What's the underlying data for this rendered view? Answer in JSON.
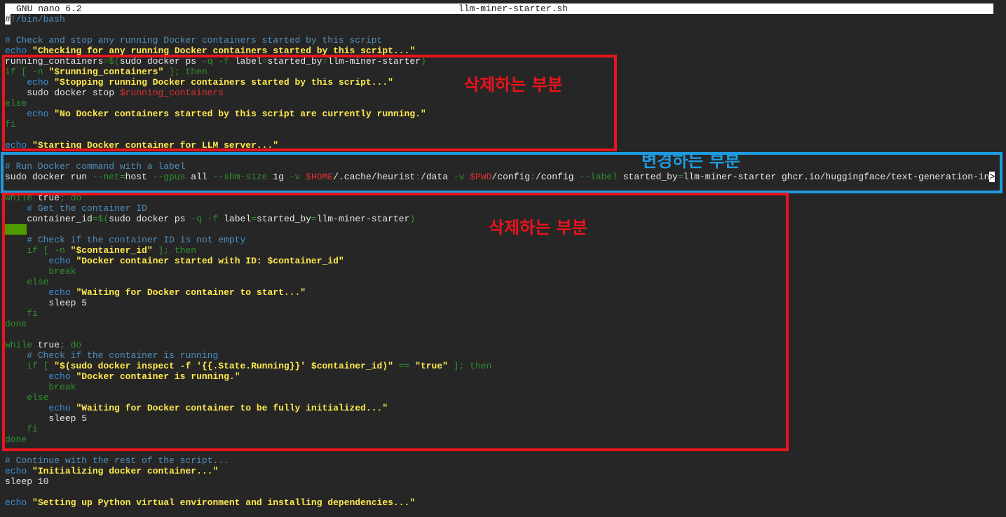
{
  "titlebar": {
    "app_name": "GNU nano 6.2",
    "file_name": "llm-miner-starter.sh"
  },
  "annotations": {
    "delete_label_1": "삭제하는 부분",
    "change_label": "변경하는 부분",
    "delete_label_2": "삭제하는 부분"
  },
  "colors": {
    "background": "#262626",
    "comment": "#4f8fbf",
    "keyword": "#2f8f2f",
    "builtin": "#3b8fd6",
    "string": "#ffe94d",
    "variable": "#e03030",
    "annotation_red": "#e8141e",
    "annotation_blue": "#1e9be0"
  },
  "lines": [
    [
      [
        "cur",
        "#"
      ],
      [
        "c",
        "!/bin/bash"
      ]
    ],
    [],
    [
      [
        "c",
        "# Check and stop any running Docker containers started by this script"
      ]
    ],
    [
      [
        "b",
        "echo"
      ],
      [
        "t",
        " "
      ],
      [
        "s",
        "\"Checking for any running Docker containers started by this script...\""
      ]
    ],
    [
      [
        "t",
        "running_containers"
      ],
      [
        "o",
        "="
      ],
      [
        "k",
        "$("
      ],
      [
        "t",
        "sudo docker ps "
      ],
      [
        "k",
        "-q"
      ],
      [
        "t",
        " "
      ],
      [
        "k",
        "-f"
      ],
      [
        "t",
        " label"
      ],
      [
        "o",
        "="
      ],
      [
        "t",
        "started_by"
      ],
      [
        "o",
        "="
      ],
      [
        "t",
        "llm-miner-starter"
      ],
      [
        "k",
        ")"
      ]
    ],
    [
      [
        "k",
        "if [ -n "
      ],
      [
        "s",
        "\"$running_containers\""
      ],
      [
        "k",
        " ]; then"
      ]
    ],
    [
      [
        "t",
        "    "
      ],
      [
        "b",
        "echo"
      ],
      [
        "t",
        " "
      ],
      [
        "s",
        "\"Stopping running Docker containers started by this script...\""
      ]
    ],
    [
      [
        "t",
        "    sudo docker stop "
      ],
      [
        "v",
        "$running_containers"
      ]
    ],
    [
      [
        "k",
        "else"
      ]
    ],
    [
      [
        "t",
        "    "
      ],
      [
        "b",
        "echo"
      ],
      [
        "t",
        " "
      ],
      [
        "s",
        "\"No Docker containers started by this script are currently running.\""
      ]
    ],
    [
      [
        "k",
        "fi"
      ]
    ],
    [],
    [
      [
        "b",
        "echo"
      ],
      [
        "t",
        " "
      ],
      [
        "s",
        "\"Starting Docker container for LLM server...\""
      ]
    ],
    [],
    [
      [
        "c",
        "# Run Docker command with a label"
      ]
    ],
    [
      [
        "t",
        "sudo docker run "
      ],
      [
        "k",
        "--net"
      ],
      [
        "o",
        "="
      ],
      [
        "t",
        "host "
      ],
      [
        "k",
        "--gpus"
      ],
      [
        "t",
        " all "
      ],
      [
        "k",
        "--shm-size"
      ],
      [
        "t",
        " 1g "
      ],
      [
        "k",
        "-v"
      ],
      [
        "t",
        " "
      ],
      [
        "v",
        "$HOME"
      ],
      [
        "t",
        "/.cache/heurist"
      ],
      [
        "o",
        ":"
      ],
      [
        "t",
        "/data "
      ],
      [
        "k",
        "-v"
      ],
      [
        "t",
        " "
      ],
      [
        "v",
        "$PWD"
      ],
      [
        "t",
        "/config"
      ],
      [
        "o",
        ":"
      ],
      [
        "t",
        "/config "
      ],
      [
        "k",
        "--label"
      ],
      [
        "t",
        " started_by"
      ],
      [
        "o",
        "="
      ],
      [
        "t",
        "llm-miner-starter ghcr.io/huggingface/text-generation-in"
      ],
      [
        "more",
        ">"
      ]
    ],
    [],
    [
      [
        "k",
        "while"
      ],
      [
        "t",
        " true"
      ],
      [
        "k",
        "; do"
      ]
    ],
    [
      [
        "t",
        "    "
      ],
      [
        "c",
        "# Get the container ID"
      ]
    ],
    [
      [
        "t",
        "    container_id"
      ],
      [
        "o",
        "="
      ],
      [
        "k",
        "$("
      ],
      [
        "t",
        "sudo docker ps "
      ],
      [
        "k",
        "-q"
      ],
      [
        "t",
        " "
      ],
      [
        "k",
        "-f"
      ],
      [
        "t",
        " label"
      ],
      [
        "o",
        "="
      ],
      [
        "t",
        "started_by"
      ],
      [
        "o",
        "="
      ],
      [
        "t",
        "llm-miner-starter"
      ],
      [
        "k",
        ")"
      ]
    ],
    [
      [
        "ws",
        "    "
      ]
    ],
    [
      [
        "t",
        "    "
      ],
      [
        "c",
        "# Check if the container ID is not empty"
      ]
    ],
    [
      [
        "t",
        "    "
      ],
      [
        "k",
        "if [ -n "
      ],
      [
        "s",
        "\"$container_id\""
      ],
      [
        "k",
        " ]; then"
      ]
    ],
    [
      [
        "t",
        "        "
      ],
      [
        "b",
        "echo"
      ],
      [
        "t",
        " "
      ],
      [
        "s",
        "\"Docker container started with ID: $container_id\""
      ]
    ],
    [
      [
        "t",
        "        "
      ],
      [
        "k",
        "break"
      ]
    ],
    [
      [
        "t",
        "    "
      ],
      [
        "k",
        "else"
      ]
    ],
    [
      [
        "t",
        "        "
      ],
      [
        "b",
        "echo"
      ],
      [
        "t",
        " "
      ],
      [
        "s",
        "\"Waiting for Docker container to start...\""
      ]
    ],
    [
      [
        "t",
        "        sleep 5"
      ]
    ],
    [
      [
        "t",
        "    "
      ],
      [
        "k",
        "fi"
      ]
    ],
    [
      [
        "k",
        "done"
      ]
    ],
    [],
    [
      [
        "k",
        "while"
      ],
      [
        "t",
        " true"
      ],
      [
        "k",
        "; do"
      ]
    ],
    [
      [
        "t",
        "    "
      ],
      [
        "c",
        "# Check if the container is running"
      ]
    ],
    [
      [
        "t",
        "    "
      ],
      [
        "k",
        "if [ "
      ],
      [
        "s",
        "\"$(sudo docker inspect -f '{{.State.Running}}' $container_id)\""
      ],
      [
        "k",
        " == "
      ],
      [
        "s",
        "\"true\""
      ],
      [
        "k",
        " ]; then"
      ]
    ],
    [
      [
        "t",
        "        "
      ],
      [
        "b",
        "echo"
      ],
      [
        "t",
        " "
      ],
      [
        "s",
        "\"Docker container is running.\""
      ]
    ],
    [
      [
        "t",
        "        "
      ],
      [
        "k",
        "break"
      ]
    ],
    [
      [
        "t",
        "    "
      ],
      [
        "k",
        "else"
      ]
    ],
    [
      [
        "t",
        "        "
      ],
      [
        "b",
        "echo"
      ],
      [
        "t",
        " "
      ],
      [
        "s",
        "\"Waiting for Docker container to be fully initialized...\""
      ]
    ],
    [
      [
        "t",
        "        sleep 5"
      ]
    ],
    [
      [
        "t",
        "    "
      ],
      [
        "k",
        "fi"
      ]
    ],
    [
      [
        "k",
        "done"
      ]
    ],
    [],
    [
      [
        "c",
        "# Continue with the rest of the script..."
      ]
    ],
    [
      [
        "b",
        "echo"
      ],
      [
        "t",
        " "
      ],
      [
        "s",
        "\"Initializing docker container...\""
      ]
    ],
    [
      [
        "t",
        "sleep 10"
      ]
    ],
    [],
    [
      [
        "b",
        "echo"
      ],
      [
        "t",
        " "
      ],
      [
        "s",
        "\"Setting up Python virtual environment and installing dependencies...\""
      ]
    ]
  ]
}
